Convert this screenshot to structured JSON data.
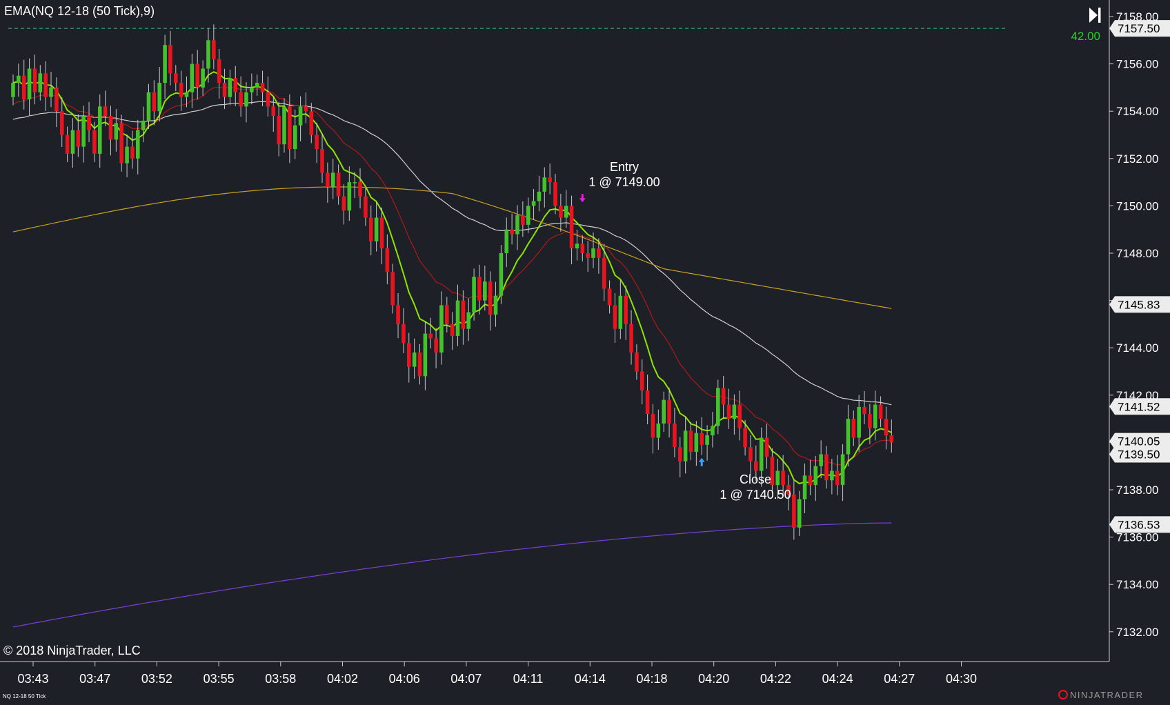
{
  "indicator_label": "EMA(NQ 12-18 (50 Tick),9)",
  "copyright": "© 2018 NinjaTrader, LLC",
  "instrument_tag": "NQ 12-18 50 Tick",
  "brand": "NINJATRADER",
  "top_value": "42.00",
  "colors": {
    "background": "#1e2027",
    "up_candle": "#44c22e",
    "down_candle": "#e8141f",
    "ema_fast": "#8ee600",
    "ema_mid": "#b01818",
    "ema_slow": "#cfcfcf",
    "ema_long": "#c8a020",
    "ema_longest": "#7a3fd6",
    "dashed_line": "#3cc07a",
    "entry_arrow": "#e020e0",
    "exit_arrow": "#3aa0ff"
  },
  "chart_data": {
    "type": "candlestick",
    "y_axis": {
      "min": 7131.0,
      "max": 7158.4,
      "ticks": [
        "7158.00",
        "7156.00",
        "7154.00",
        "7152.00",
        "7150.00",
        "7148.00",
        "7146.00",
        "7144.00",
        "7142.00",
        "7140.00",
        "7138.00",
        "7136.00",
        "7134.00",
        "7132.00"
      ]
    },
    "price_markers": [
      "7157.50",
      "7145.83",
      "7141.52",
      "7140.05",
      "7139.50",
      "7136.53"
    ],
    "x_labels": [
      "03:43",
      "03:47",
      "03:52",
      "03:55",
      "03:58",
      "04:02",
      "04:06",
      "04:07",
      "04:11",
      "04:14",
      "04:18",
      "04:20",
      "04:22",
      "04:24",
      "04:27",
      "04:30"
    ],
    "dashed_level": 7157.5,
    "annotations": {
      "entry_title": "Entry",
      "entry_detail": "1 @ 7149.00",
      "exit_title": "Close",
      "exit_detail": "1 @ 7140.50"
    },
    "closes": [
      7155.2,
      7155.5,
      7154.5,
      7155.8,
      7154.8,
      7155.6,
      7154.6,
      7155.0,
      7154.0,
      7153.0,
      7152.2,
      7153.2,
      7152.5,
      7153.8,
      7153.2,
      7152.2,
      7154.2,
      7153.8,
      7152.8,
      7153.5,
      7151.8,
      7152.5,
      7152.0,
      7153.2,
      7153.6,
      7154.8,
      7154.0,
      7155.2,
      7156.8,
      7155.6,
      7155.2,
      7154.6,
      7154.8,
      7156.0,
      7155.0,
      7155.8,
      7157.0,
      7156.2,
      7155.2,
      7154.6,
      7155.4,
      7154.8,
      7154.2,
      7154.8,
      7155.0,
      7155.2,
      7154.8,
      7154.2,
      7153.8,
      7152.6,
      7154.2,
      7152.4,
      7153.4,
      7154.2,
      7154.0,
      7153.0,
      7152.4,
      7151.4,
      7150.8,
      7151.4,
      7150.4,
      7149.8,
      7151.0,
      7151.0,
      7150.4,
      7149.5,
      7148.5,
      7149.5,
      7148.2,
      7147.2,
      7145.8,
      7145.0,
      7144.2,
      7143.2,
      7143.8,
      7142.8,
      7144.6,
      7144.4,
      7143.8,
      7145.8,
      7145.0,
      7144.5,
      7146.0,
      7144.8,
      7145.5,
      7147.0,
      7146.0,
      7146.8,
      7145.4,
      7146.2,
      7148.0,
      7149.0,
      7148.8,
      7149.6,
      7149.2,
      7150.0,
      7150.2,
      7150.6,
      7151.2,
      7151.0,
      7150.0,
      7149.5,
      7150.0,
      7148.2,
      7148.4,
      7148.0,
      7147.8,
      7148.2,
      7147.8,
      7146.5,
      7145.8,
      7144.8,
      7146.2,
      7145.0,
      7143.8,
      7143.0,
      7142.2,
      7141.2,
      7140.2,
      7140.8,
      7141.8,
      7140.8,
      7139.8,
      7139.2,
      7140.5,
      7139.6,
      7140.4,
      7139.9,
      7140.3,
      7140.7,
      7142.3,
      7141.6,
      7141.0,
      7141.6,
      7140.6,
      7139.8,
      7139.2,
      7138.8,
      7140.2,
      7139.4,
      7138.2,
      7138.8,
      7138.2,
      7137.8,
      7136.4,
      7137.6,
      7138.6,
      7138.2,
      7139.0,
      7139.5,
      7138.4,
      7138.8,
      7138.2,
      7139.5,
      7141.0,
      7140.2,
      7141.5,
      7141.2,
      7140.6,
      7141.6,
      7141.0,
      7140.3,
      7140.0
    ]
  }
}
